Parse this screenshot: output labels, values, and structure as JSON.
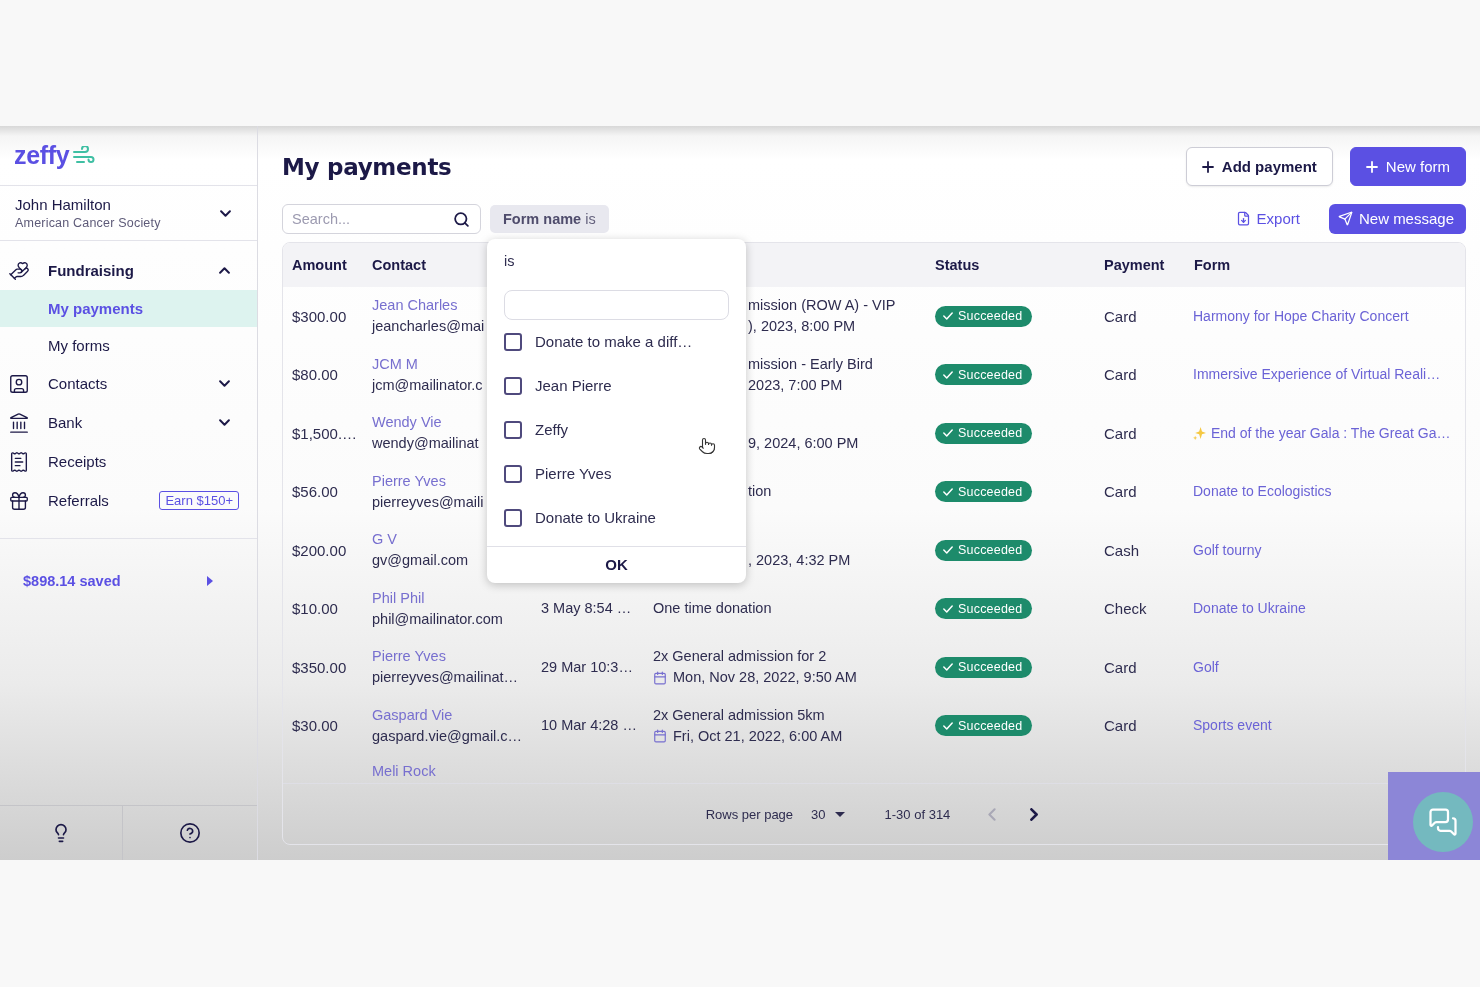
{
  "sidebar": {
    "logo": "zeffy",
    "account": {
      "name": "John Hamilton",
      "organization": "American Cancer Society",
      "expanded": false
    },
    "nav": [
      {
        "label": "Fundraising",
        "selected": false,
        "expanded": true,
        "children": [
          {
            "label": "My payments",
            "selected": true
          },
          {
            "label": "My forms",
            "selected": false
          }
        ]
      },
      {
        "label": "Contacts",
        "selected": false,
        "expanded": false
      },
      {
        "label": "Bank",
        "selected": false,
        "expanded": false
      },
      {
        "label": "Receipts",
        "selected": false
      },
      {
        "label": "Referrals",
        "selected": false,
        "badge": "Earn $150+"
      }
    ],
    "savings": "$898.14 saved"
  },
  "header": {
    "title": "My payments",
    "actions": [
      {
        "label": "Add payment",
        "kind": "outline"
      },
      {
        "label": "New form",
        "kind": "primary"
      }
    ]
  },
  "toolbar": {
    "search": {
      "placeholder": "Search..."
    },
    "filter_chip": "**Form name** is",
    "export": "Export",
    "new_message": "New message"
  },
  "filter_popover": {
    "operator": "is",
    "options": [
      {
        "label": "Donate to make a diff…",
        "checked": false
      },
      {
        "label": "Jean Pierre",
        "checked": false
      },
      {
        "label": "Zeffy",
        "checked": false
      },
      {
        "label": "Pierre Yves",
        "checked": false
      },
      {
        "label": "Donate to Ukraine",
        "checked": false
      }
    ],
    "confirm": "OK"
  },
  "table": {
    "columns": [
      "Amount",
      "Contact",
      "Status",
      "Payment",
      "Form"
    ],
    "rows": [
      {
        "amount": "$300.00",
        "contact": {
          "name": "Jean Charles",
          "email": "jeancharles@mai"
        },
        "description": {
          "title": "mission (ROW A) - VIP",
          "date": "), 2023, 8:00 PM"
        },
        "status": {
          "label": "Succeeded",
          "kind": "success"
        },
        "payment": "Card",
        "form": {
          "label": "Harmony for Hope Charity Concert"
        }
      },
      {
        "amount": "$80.00",
        "contact": {
          "name": "JCM M",
          "email": "jcm@mailinator.c"
        },
        "description": {
          "title": "mission - Early Bird",
          "date": "2023, 7:00 PM"
        },
        "status": {
          "label": "Succeeded",
          "kind": "success"
        },
        "payment": "Card",
        "form": {
          "label": "Immersive Experience of Virtual Reali…"
        }
      },
      {
        "amount": "$1,500.…",
        "contact": {
          "name": "Wendy Vie",
          "email": "wendy@mailinat"
        },
        "description": {
          "date": "9, 2024, 6:00 PM"
        },
        "status": {
          "label": "Succeeded",
          "kind": "success"
        },
        "payment": "Card",
        "form": {
          "label": "End of the year Gala : The Great Ga…",
          "sparkle": true
        }
      },
      {
        "amount": "$56.00",
        "contact": {
          "name": "Pierre Yves",
          "email": "pierreyves@maili"
        },
        "description": {
          "title": "tion"
        },
        "status": {
          "label": "Succeeded",
          "kind": "success"
        },
        "payment": "Card",
        "form": {
          "label": "Donate to Ecologistics"
        }
      },
      {
        "amount": "$200.00",
        "contact": {
          "name": "G V",
          "email": "gv@gmail.com"
        },
        "description": {
          "date": ", 2023, 4:32 PM"
        },
        "status": {
          "label": "Succeeded",
          "kind": "success"
        },
        "payment": "Cash",
        "form": {
          "label": "Golf tourny"
        }
      },
      {
        "amount": "$10.00",
        "contact": {
          "name": "Phil Phil",
          "email": "phil@mailinator.com"
        },
        "date": "3 May 8:54 …",
        "description": {
          "title": "One time donation"
        },
        "status": {
          "label": "Succeeded",
          "kind": "success"
        },
        "payment": "Check",
        "form": {
          "label": "Donate to Ukraine"
        }
      },
      {
        "amount": "$350.00",
        "contact": {
          "name": "Pierre Yves",
          "email": "pierreyves@mailinat…"
        },
        "date": "29 Mar 10:3…",
        "description": {
          "title": "2x General admission for 2",
          "date": "Mon, Nov 28, 2022, 9:50 AM"
        },
        "status": {
          "label": "Succeeded",
          "kind": "success"
        },
        "payment": "Card",
        "form": {
          "label": "Golf"
        }
      },
      {
        "amount": "$30.00",
        "contact": {
          "name": "Gaspard Vie",
          "email": "gaspard.vie@gmail.c…"
        },
        "date": "10 Mar 4:28 …",
        "description": {
          "title": "2x General admission 5km",
          "date": "Fri, Oct 21, 2022, 6:00 AM"
        },
        "status": {
          "label": "Succeeded",
          "kind": "success"
        },
        "payment": "Card",
        "form": {
          "label": "Sports event"
        }
      }
    ],
    "next_row_peek": {
      "name": "Meli Rock"
    },
    "pagination": {
      "rows_per_page_label": "Rows per page",
      "rows_per_page": "30",
      "range": "1-30 of 314",
      "previous": {
        "disabled": true
      },
      "next": {
        "disabled": false
      }
    }
  }
}
